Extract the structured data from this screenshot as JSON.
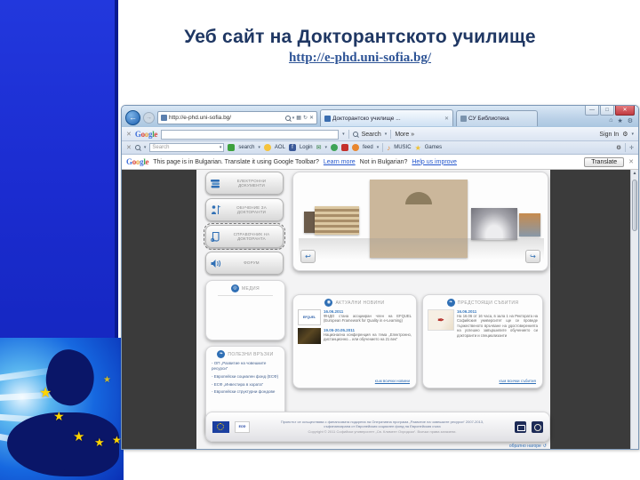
{
  "slide": {
    "title": "Уеб сайт на Докторантското училище",
    "link": "http://e-phd.uni-sofia.bg/"
  },
  "browser": {
    "url": "http://e-phd.uni-sofia.bg/",
    "tabs": [
      {
        "title": "Докторантско училище ..."
      },
      {
        "title": "СУ Библиотека"
      }
    ],
    "google_toolbar": {
      "search_label": "Search",
      "more_label": "More »",
      "signin_label": "Sign In"
    },
    "toolbar2": {
      "search_placeholder": "Search",
      "search_label": "search",
      "aol_label": "AOL",
      "login_label": "Login",
      "feed_label": "feed",
      "music_label": "MUSIC",
      "games_label": "Games"
    },
    "translate_bar": {
      "message": "This page is in Bulgarian. Translate it using Google Toolbar?",
      "learn_more": "Learn more",
      "not_bulgarian": "Not in Bulgarian?",
      "help_improve": "Help us improve",
      "translate_button": "Translate"
    }
  },
  "webpage": {
    "menu": [
      {
        "label": "ЕЛЕКТРОННИ ДОКУМЕНТИ"
      },
      {
        "label": "ОБУЧЕНИЕ ЗА ДОКТОРАНТИ"
      },
      {
        "label": "СПРАВОЧНИК НА ДОКТОРАНТА"
      },
      {
        "label": "ФОРУМ"
      }
    ],
    "media_card": {
      "title": "МЕДИЯ"
    },
    "links_card": {
      "title": "ПОЛЕЗНИ ВРЪЗКИ",
      "items": [
        "- ОП „Развитие на човешките ресурси“",
        "- Европейски социален фонд (ЕСФ)",
        "- ЕСФ „Инвестира в хората“",
        "- Европейски структурни фондове"
      ]
    },
    "news_card": {
      "title": "АКТУАЛНИ НОВИНИ",
      "items": [
        {
          "date": "16.06.2011",
          "thumb_label": "EFQUEL",
          "text": "ФНДО стана асоцииран член на EFQUEL (European Framework for Quality in e-Learning)"
        },
        {
          "date": "19.05-20.05.2011",
          "text": "Национална конференция на тема „Електронно, дистанционно... или обучението на 21 век“"
        }
      ],
      "more_link": "към всички новини"
    },
    "events_card": {
      "title": "ПРЕДСТОЯЩИ СЪБИТИЯ",
      "items": [
        {
          "date": "16.06.2011",
          "text": "На 16.06 от 16 часа, в зала 1 на Ректората на Софийския университет ще се проведе тържественото връчване на удостоверенията на успешно завършилите обучението си докторанти и специализанти"
        }
      ],
      "more_link": "към всички събития"
    },
    "footer": {
      "esf_label": "ЕСФ",
      "line1": "Проектът се осъществява с финансовата подкрепа на Оперативна програма „Развитие на човешките ресурси“ 2007-2013,",
      "line2": "съфинансирана от Европейския социален фонд на Европейския съюз",
      "line3": "Copyright © 2011 Софийски университет „Св. Климент Охридски“. Всички права запазени."
    },
    "back_to_top": "обратно нагоре"
  },
  "icons": {
    "back": "←",
    "forward": "→",
    "caret": "▾",
    "refresh": "↻",
    "stop": "✕",
    "compat": "▦",
    "home": "⌂",
    "favorite": "★",
    "gear": "⚙",
    "minimize": "—",
    "maximize": "□",
    "close": "✕",
    "x": "✕",
    "envelope": "✉",
    "music_note": "♪",
    "star": "★",
    "plus": "✛",
    "arrow_left": "↩",
    "arrow_right": "↪",
    "up": "▲",
    "back_top": "↺",
    "globe": "◉",
    "bird": "❧",
    "media": "◎",
    "quill": "✒"
  },
  "colors": {
    "sidebar_blue": "#1b2cd0",
    "title_navy": "#1f3763",
    "link_blue": "#2e5496",
    "viewport_gray": "#3b3b3b",
    "accent_blue": "#2f6fb5",
    "date_blue": "#3a7bbf",
    "page_link_blue": "#2e6db4",
    "eu_star_yellow": "#ffd400"
  }
}
